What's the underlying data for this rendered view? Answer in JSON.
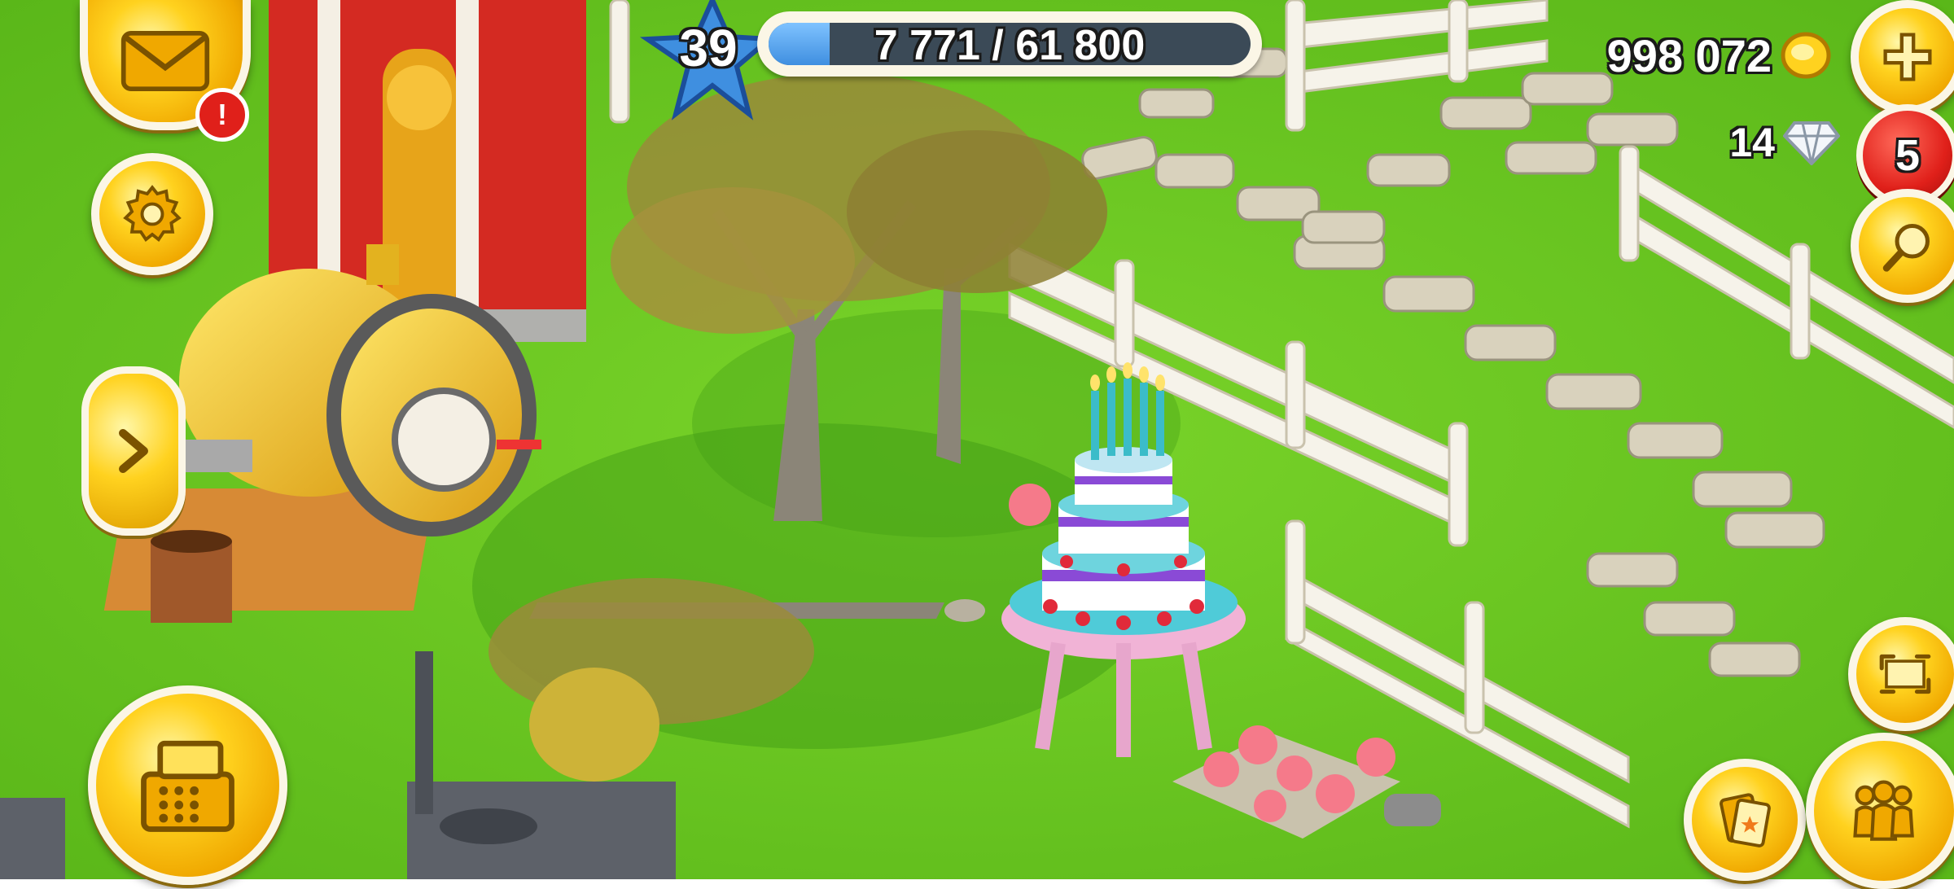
{
  "hud": {
    "level": "39",
    "xp_text": "7 771 / 61 800",
    "xp_progress": 0.126,
    "coins": "998 072",
    "diamonds": "14",
    "notification_badge": "!",
    "cart_count": "5"
  },
  "buttons": {
    "mail": "mail-icon",
    "settings": "gear-icon",
    "expand": "chevron-right-icon",
    "shop": "cash-register-icon",
    "add_coins": "plus-icon",
    "search": "magnifier-icon",
    "edit_mode": "expand-arrows-icon",
    "cards": "cards-icon",
    "friends": "friends-icon"
  },
  "colors": {
    "grass": "#66c21e",
    "gold": "#ffd21f",
    "red_badge": "#e0201a",
    "xp_fill": "#3f8fe0"
  }
}
